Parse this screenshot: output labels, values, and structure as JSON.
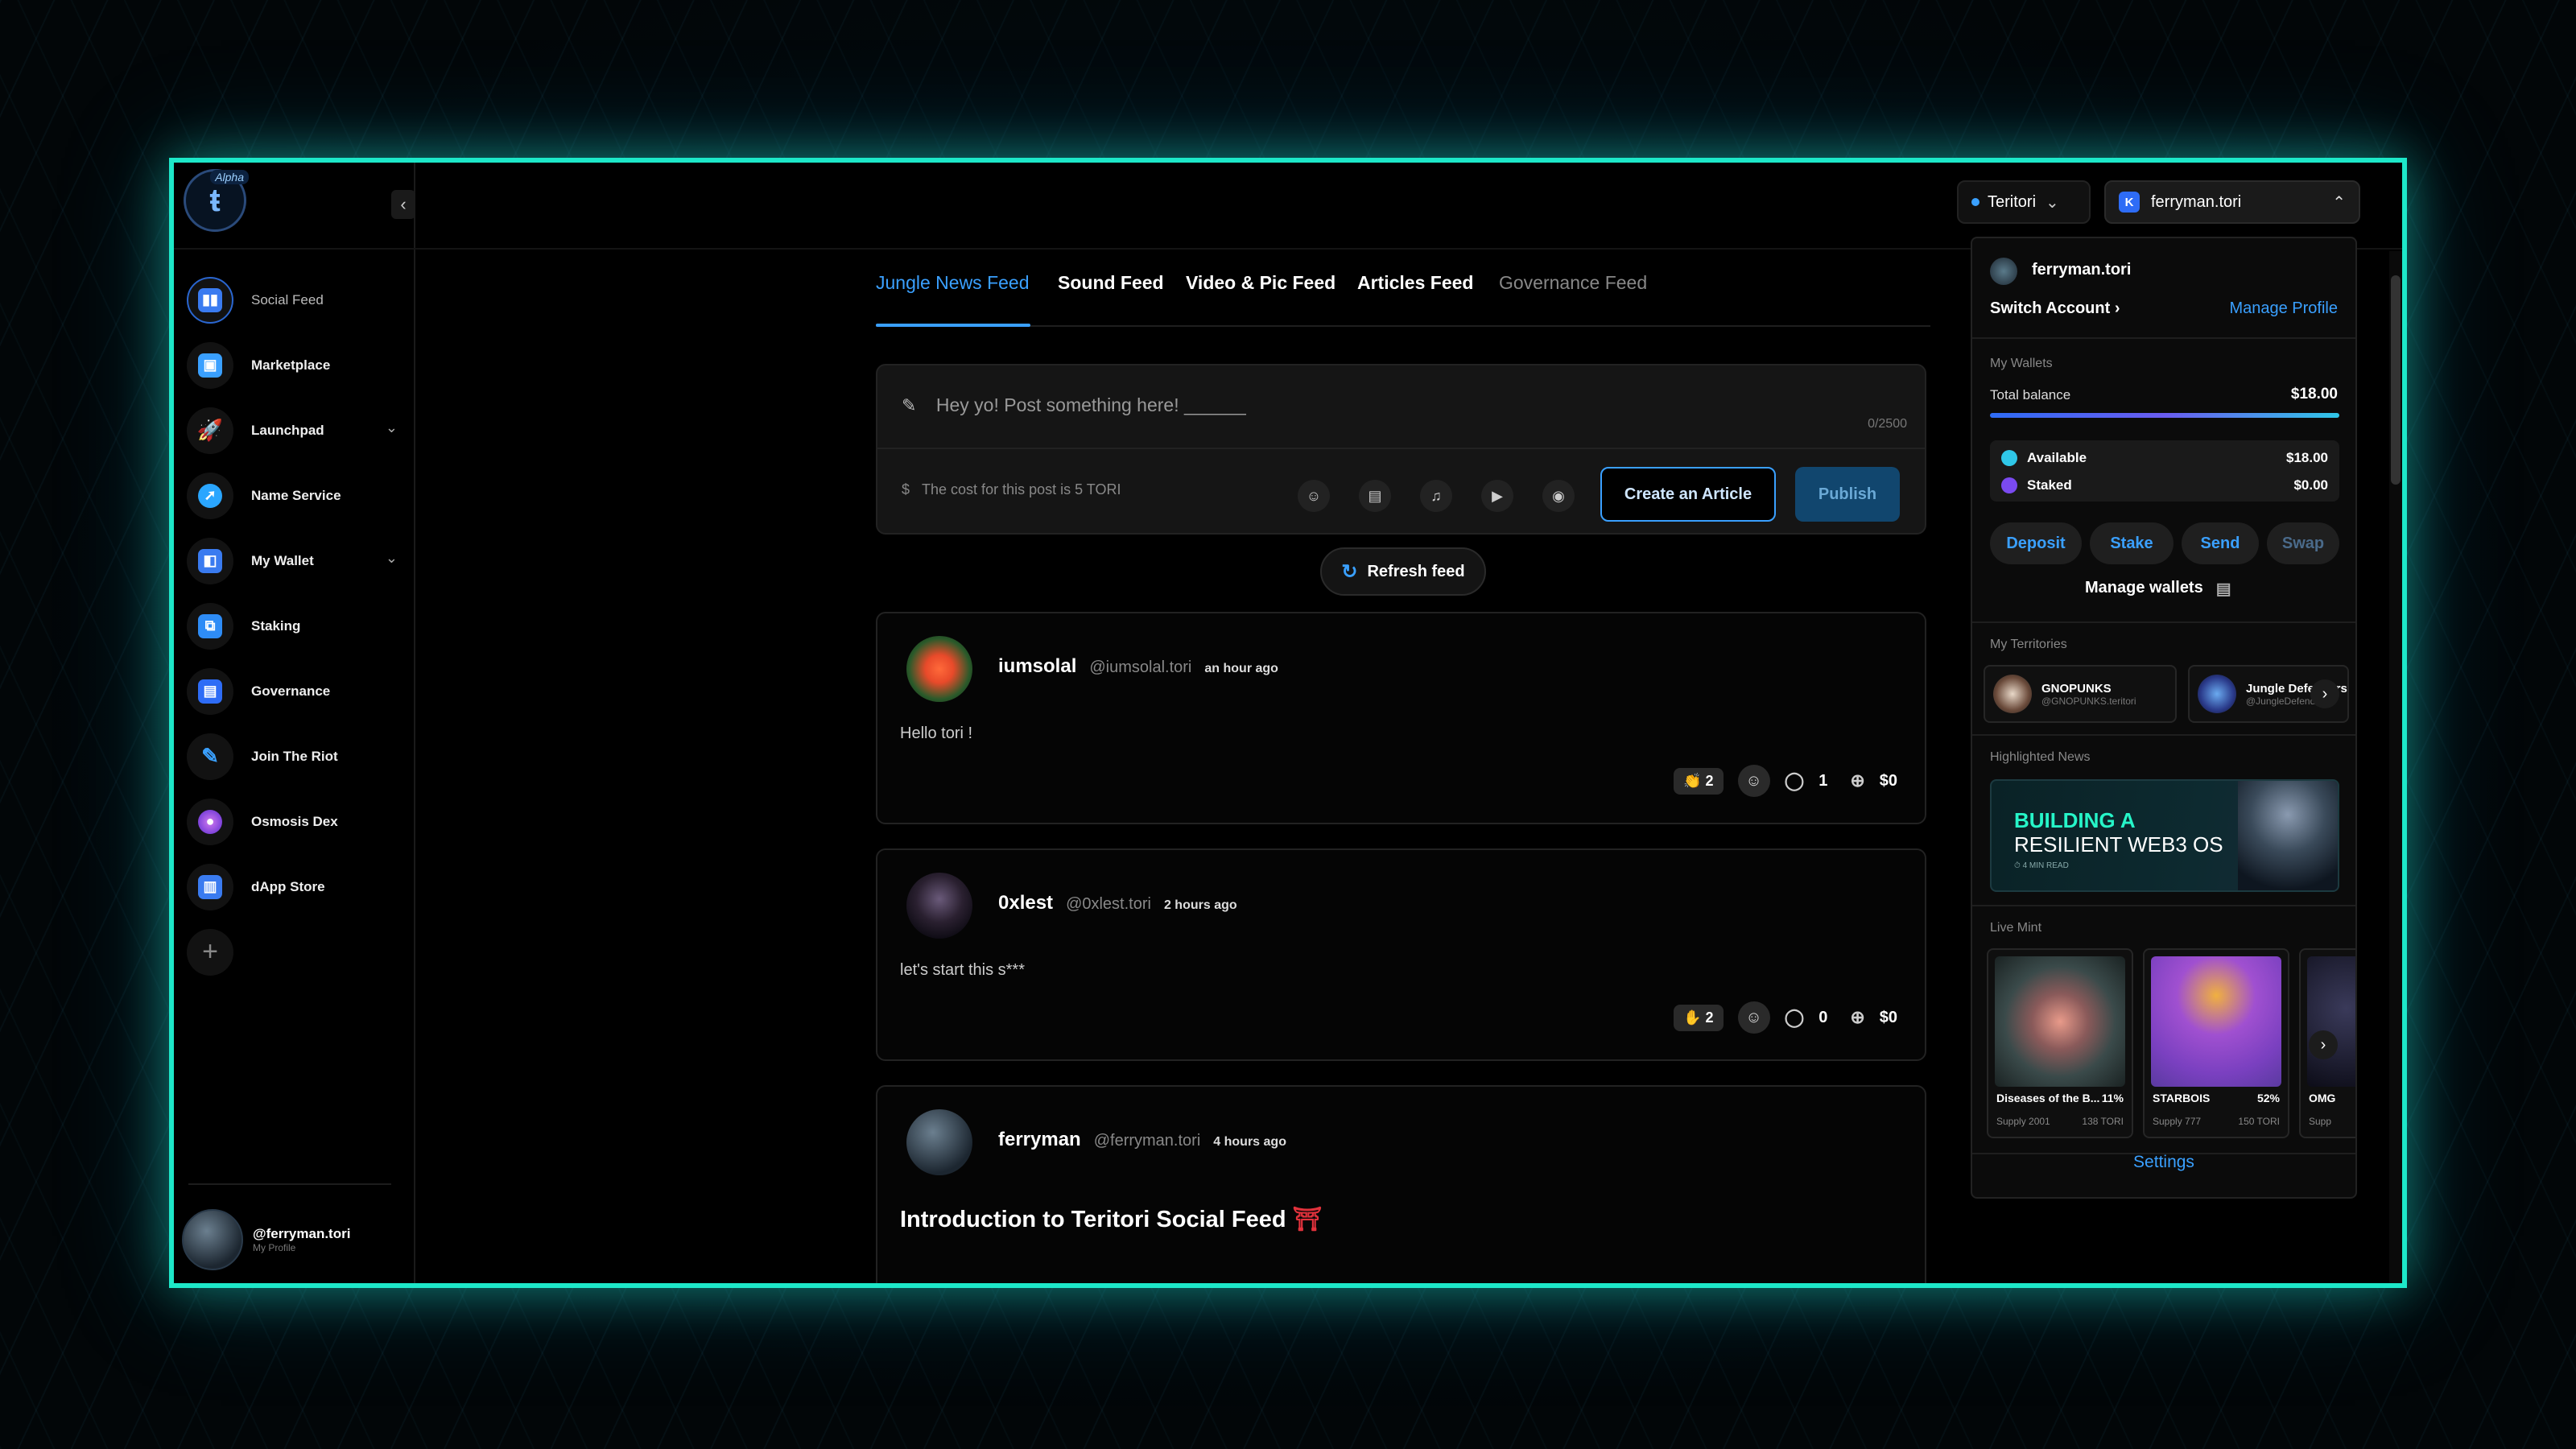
{
  "sidebar": {
    "logo_badge": "Alpha",
    "items": [
      {
        "label": "Social Feed",
        "icon": "social-feed-icon",
        "color": "#3a7bf0"
      },
      {
        "label": "Marketplace",
        "icon": "marketplace-icon",
        "color": "#3aa0ff"
      },
      {
        "label": "Launchpad",
        "icon": "rocket-icon",
        "color": "#2e6cf6"
      },
      {
        "label": "Name Service",
        "icon": "compass-icon",
        "color": "#2aa6ff"
      },
      {
        "label": "My Wallet",
        "icon": "wallet-icon",
        "color": "#3a7bf0"
      },
      {
        "label": "Staking",
        "icon": "staking-icon",
        "color": "#2e8cf6"
      },
      {
        "label": "Governance",
        "icon": "governance-icon",
        "color": "#2e6cf6"
      },
      {
        "label": "Join The Riot",
        "icon": "riot-icon",
        "color": "#3aa0ff"
      },
      {
        "label": "Osmosis Dex",
        "icon": "osmosis-icon",
        "color": "#8a4af0"
      },
      {
        "label": "dApp Store",
        "icon": "dapp-store-icon",
        "color": "#3a7bf0"
      }
    ],
    "profile_handle": "@ferryman.tori",
    "profile_sub": "My Profile"
  },
  "header": {
    "network": "Teritori",
    "account": "ferryman.tori",
    "account_badge": "K"
  },
  "feed": {
    "tabs": [
      "Jungle News Feed",
      "Sound Feed",
      "Video & Pic Feed",
      "Articles Feed",
      "Governance Feed"
    ],
    "composer_placeholder": "Hey yo! Post something here! ______",
    "char_count": "0/2500",
    "cost_prefix": "$",
    "cost_text": "The cost for this post is 5 TORI",
    "create_article": "Create an Article",
    "publish": "Publish",
    "refresh": "Refresh feed",
    "posts": [
      {
        "name": "iumsolal",
        "handle": "@iumsolal.tori",
        "time": "an hour ago",
        "body": "Hello tori !",
        "reaction": "👏 2",
        "comments": "1",
        "tips": "$0"
      },
      {
        "name": "0xlest",
        "handle": "@0xlest.tori",
        "time": "2 hours ago",
        "body": "let's start this s***",
        "reaction": "✋ 2",
        "comments": "0",
        "tips": "$0"
      },
      {
        "name": "ferryman",
        "handle": "@ferryman.tori",
        "time": "4 hours ago",
        "title": "Introduction to Teritori Social Feed",
        "title_emoji": "⛩"
      }
    ]
  },
  "wallet_panel": {
    "name": "ferryman.tori",
    "switch_account": "Switch Account",
    "manage_profile": "Manage Profile",
    "my_wallets": "My Wallets",
    "total_balance_label": "Total balance",
    "total_balance": "$18.00",
    "available_label": "Available",
    "available": "$18.00",
    "staked_label": "Staked",
    "staked": "$0.00",
    "buttons": [
      "Deposit",
      "Stake",
      "Send",
      "Swap"
    ],
    "manage_wallets": "Manage wallets",
    "my_territories": "My Territories",
    "territories": [
      {
        "name": "GNOPUNKS",
        "handle": "@GNOPUNKS.teritori"
      },
      {
        "name": "Jungle Defenders",
        "handle": "@JungleDefenders"
      }
    ],
    "highlighted_news": "Highlighted News",
    "news_line1": "BUILDING A",
    "news_line2": "RESILIENT WEB3 OS",
    "news_line3": "⏱ 4 MIN READ",
    "live_mint": "Live Mint",
    "mints": [
      {
        "name": "Diseases of the B...",
        "pct": "11%",
        "supply": "Supply 2001",
        "price": "138 TORI"
      },
      {
        "name": "STARBOIS",
        "pct": "52%",
        "supply": "Supply 777",
        "price": "150 TORI"
      },
      {
        "name": "OMG",
        "pct": "",
        "supply": "Supp",
        "price": ""
      }
    ],
    "settings": "Settings"
  },
  "colors": {
    "accent": "#3aa0ff",
    "frame": "#1de8c9",
    "available_dot": "#2fc7e8",
    "staked_dot": "#7a4af0"
  }
}
